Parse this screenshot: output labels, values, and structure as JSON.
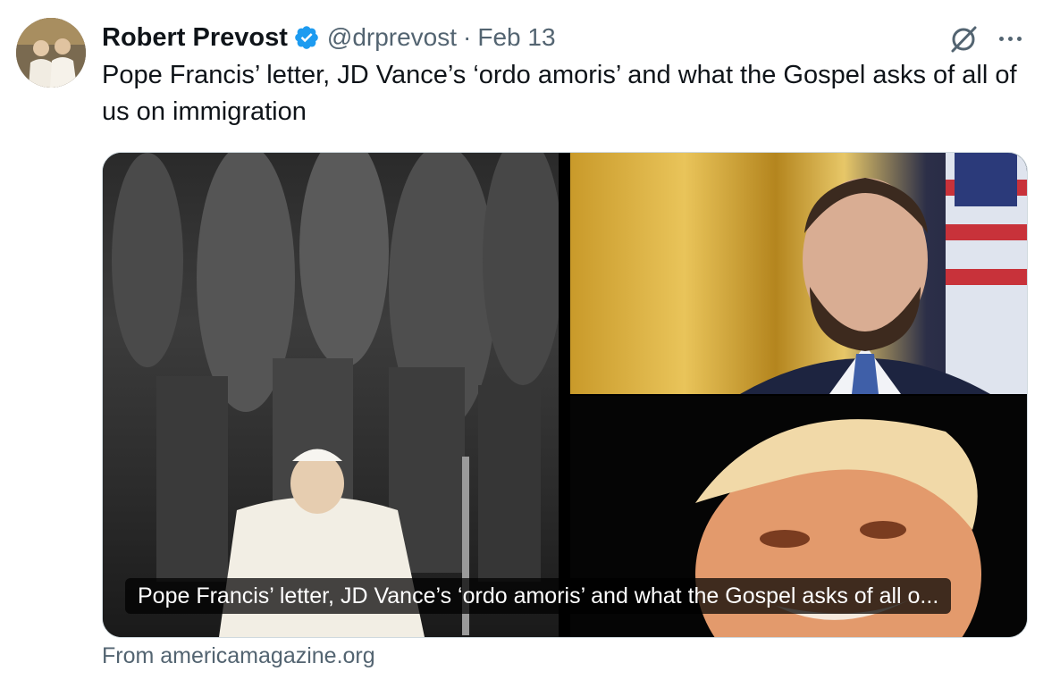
{
  "tweet": {
    "author_name": "Robert Prevost",
    "handle": "@drprevost",
    "separator": "·",
    "date": "Feb 13",
    "text": "Pope Francis’ letter, JD Vance’s ‘ordo amoris’ and what the Gospel asks of all of us on immigration"
  },
  "card": {
    "caption": "Pope Francis’ letter, JD Vance’s ‘ordo amoris’ and what the Gospel asks of all o...",
    "source": "From americamagazine.org"
  },
  "icons": {
    "avatar": "avatar",
    "verified": "verified-badge-icon",
    "grok": "grok-icon",
    "more": "more-options-icon"
  },
  "colors": {
    "text": "#0f1419",
    "secondary": "#536471",
    "verified": "#1d9bf0",
    "border": "#cfd9de"
  }
}
